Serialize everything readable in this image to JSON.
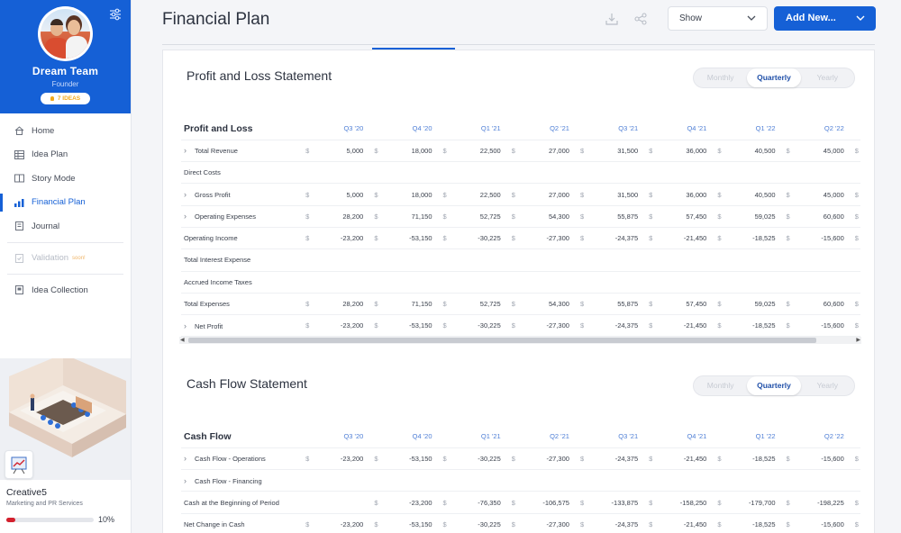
{
  "sidebar": {
    "profile": {
      "name": "Dream Team",
      "role": "Founder",
      "ideas_badge": "7 IDEAS"
    },
    "nav": [
      {
        "label": "Home",
        "icon": "home-icon",
        "state": "normal"
      },
      {
        "label": "Idea Plan",
        "icon": "table-icon",
        "state": "normal"
      },
      {
        "label": "Story Mode",
        "icon": "story-icon",
        "state": "normal"
      },
      {
        "label": "Financial Plan",
        "icon": "chart-icon",
        "state": "active"
      },
      {
        "label": "Journal",
        "icon": "journal-icon",
        "state": "normal"
      },
      {
        "label": "Validation",
        "icon": "validation-icon",
        "state": "disabled",
        "badge": "soon!"
      },
      {
        "label": "Idea Collection",
        "icon": "collection-icon",
        "state": "normal"
      }
    ],
    "company": {
      "name": "Creative5",
      "description": "Marketing and PR Services",
      "progress_label": "10%",
      "progress": 0.1
    }
  },
  "header": {
    "title": "Financial Plan",
    "show_select": "Show",
    "add_button": "Add New..."
  },
  "colors": {
    "brand": "#1560d6",
    "progress": "#d3202d",
    "header_text": "#4f7fd6"
  },
  "periods": [
    "Q3 '20",
    "Q4 '20",
    "Q1 '21",
    "Q2 '21",
    "Q3 '21",
    "Q4 '21",
    "Q1 '22",
    "Q2 '22"
  ],
  "segmented": [
    "Monthly",
    "Quarterly",
    "Yearly"
  ],
  "pl": {
    "title": "Profit and Loss Statement",
    "table_title": "Profit and Loss",
    "rows": [
      {
        "label": "Total Revenue",
        "expand": true,
        "values": [
          "5,000",
          "18,000",
          "22,500",
          "27,000",
          "31,500",
          "36,000",
          "40,500",
          "45,000"
        ]
      },
      {
        "label": "Direct Costs",
        "expand": false,
        "values": []
      },
      {
        "label": "Gross Profit",
        "expand": true,
        "values": [
          "5,000",
          "18,000",
          "22,500",
          "27,000",
          "31,500",
          "36,000",
          "40,500",
          "45,000"
        ]
      },
      {
        "label": "Operating Expenses",
        "expand": true,
        "values": [
          "28,200",
          "71,150",
          "52,725",
          "54,300",
          "55,875",
          "57,450",
          "59,025",
          "60,600"
        ]
      },
      {
        "label": "Operating Income",
        "expand": false,
        "values": [
          "-23,200",
          "-53,150",
          "-30,225",
          "-27,300",
          "-24,375",
          "-21,450",
          "-18,525",
          "-15,600"
        ]
      },
      {
        "label": "Total Interest Expense",
        "expand": false,
        "values": []
      },
      {
        "label": "Accrued Income Taxes",
        "expand": false,
        "values": []
      },
      {
        "label": "Total Expenses",
        "expand": false,
        "values": [
          "28,200",
          "71,150",
          "52,725",
          "54,300",
          "55,875",
          "57,450",
          "59,025",
          "60,600"
        ]
      },
      {
        "label": "Net Profit",
        "expand": true,
        "values": [
          "-23,200",
          "-53,150",
          "-30,225",
          "-27,300",
          "-24,375",
          "-21,450",
          "-18,525",
          "-15,600"
        ]
      }
    ]
  },
  "cf": {
    "title": "Cash Flow Statement",
    "table_title": "Cash Flow",
    "rows": [
      {
        "label": "Cash Flow - Operations",
        "expand": true,
        "values": [
          "-23,200",
          "-53,150",
          "-30,225",
          "-27,300",
          "-24,375",
          "-21,450",
          "-18,525",
          "-15,600"
        ]
      },
      {
        "label": "Cash Flow - Financing",
        "expand": true,
        "values": []
      },
      {
        "label": "Cash at the Beginning of Period",
        "expand": false,
        "values": [
          "",
          "-23,200",
          "-76,350",
          "-106,575",
          "-133,875",
          "-158,250",
          "-179,700",
          "-198,225"
        ]
      },
      {
        "label": "Net Change in Cash",
        "expand": false,
        "values": [
          "-23,200",
          "-53,150",
          "-30,225",
          "-27,300",
          "-24,375",
          "-21,450",
          "-18,525",
          "-15,600"
        ]
      }
    ]
  }
}
